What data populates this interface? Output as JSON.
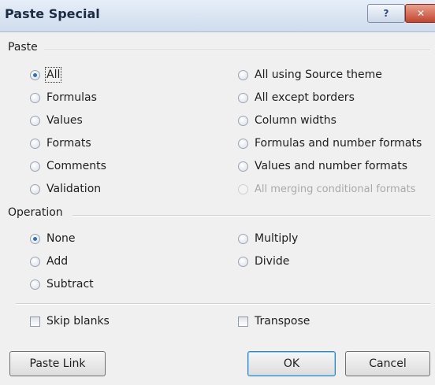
{
  "dialog": {
    "title": "Paste Special",
    "help_glyph": "?",
    "close_glyph": "✕"
  },
  "paste": {
    "section_label": "Paste",
    "selected": "All",
    "left_options": [
      "All",
      "Formulas",
      "Values",
      "Formats",
      "Comments",
      "Validation"
    ],
    "right_options": [
      "All using Source theme",
      "All except borders",
      "Column widths",
      "Formulas and number formats",
      "Values and number formats",
      "All merging conditional formats"
    ],
    "disabled": [
      "All merging conditional formats"
    ]
  },
  "operation": {
    "section_label": "Operation",
    "selected": "None",
    "left_options": [
      "None",
      "Add",
      "Subtract"
    ],
    "right_options": [
      "Multiply",
      "Divide"
    ]
  },
  "checkboxes": {
    "skip_blanks": {
      "label": "Skip blanks",
      "checked": false
    },
    "transpose": {
      "label": "Transpose",
      "checked": false
    }
  },
  "buttons": {
    "paste_link": "Paste Link",
    "ok": "OK",
    "cancel": "Cancel"
  },
  "colors": {
    "accent": "#2a6fc8",
    "titlebar": "#d7e3f1",
    "close": "#c2462e"
  }
}
